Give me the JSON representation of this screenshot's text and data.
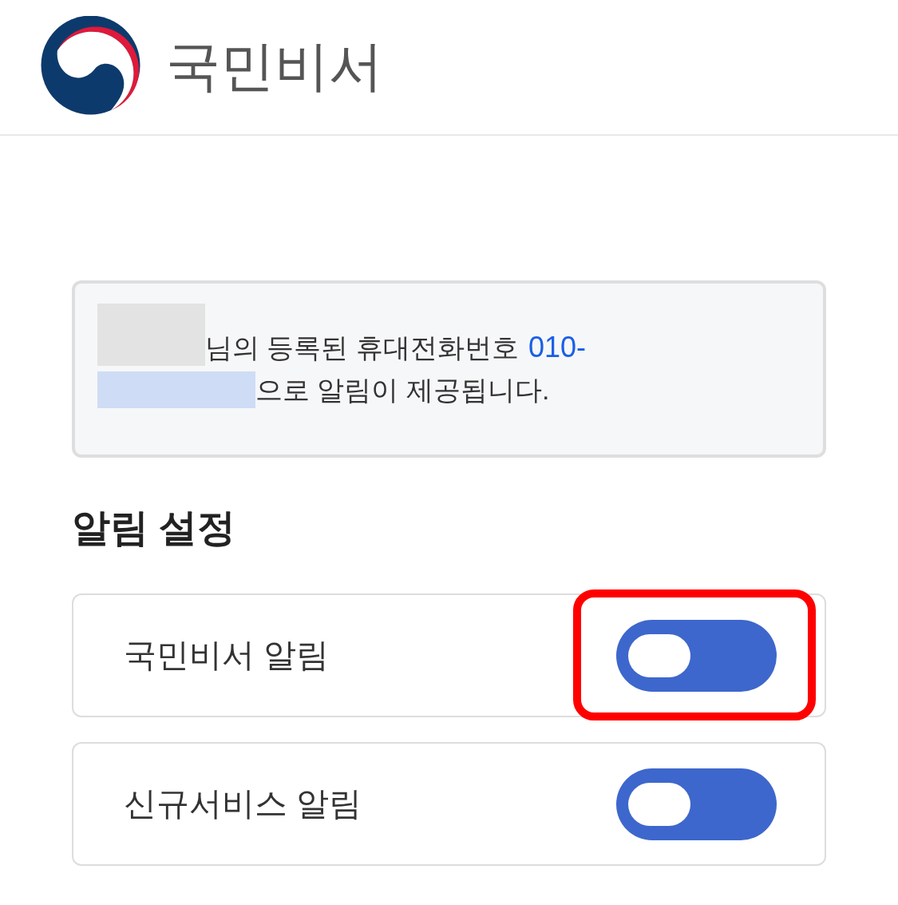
{
  "header": {
    "title": "국민비서"
  },
  "notice": {
    "lines": [
      [
        {
          "kind": "redacted",
          "color": "#e3e3e3"
        },
        {
          "kind": "text",
          "text": "님의 등록된 휴대전화번호"
        },
        {
          "kind": "phone",
          "text": "010-"
        }
      ],
      [
        {
          "kind": "redacted",
          "color": "#cfdcf5"
        },
        {
          "kind": "text",
          "text": "으로 알림이 제공됩니다."
        }
      ]
    ]
  },
  "settings": {
    "title": "알림 설정",
    "items": [
      {
        "label": "국민비서 알림",
        "on": true,
        "annotated": true
      },
      {
        "label": "신규서비스 알림",
        "on": true,
        "annotated": false
      }
    ]
  }
}
